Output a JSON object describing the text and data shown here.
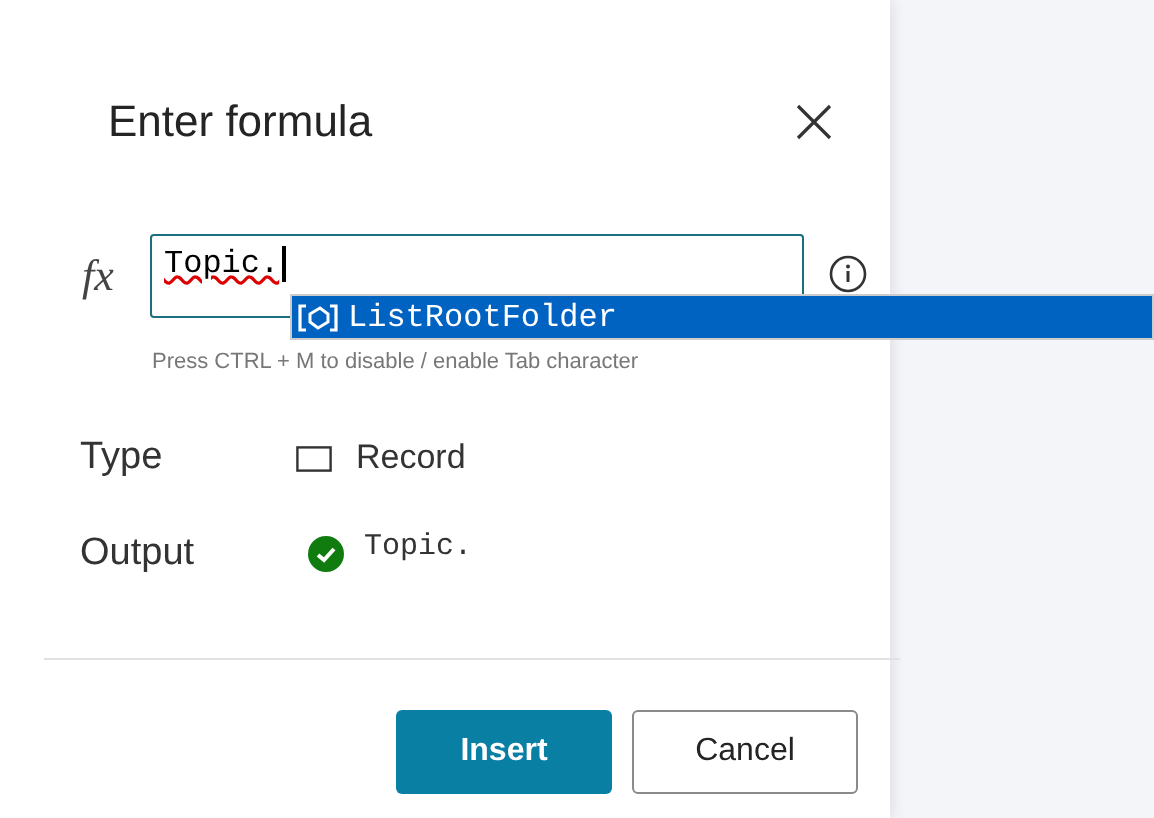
{
  "dialog": {
    "title": "Enter formula"
  },
  "formula": {
    "label": "fx",
    "value": "Topic.",
    "hint": "Press CTRL + M to disable / enable Tab character"
  },
  "suggestions": [
    {
      "label": "ListRootFolder",
      "selected": true
    }
  ],
  "fields": [
    {
      "kind": "type",
      "label": "Type",
      "value": "Record"
    },
    {
      "kind": "output",
      "label": "Output",
      "value": "Topic.",
      "valid": true
    }
  ],
  "buttons": [
    {
      "label": "Insert",
      "primary": true
    },
    {
      "label": "Cancel",
      "primary": false
    }
  ]
}
